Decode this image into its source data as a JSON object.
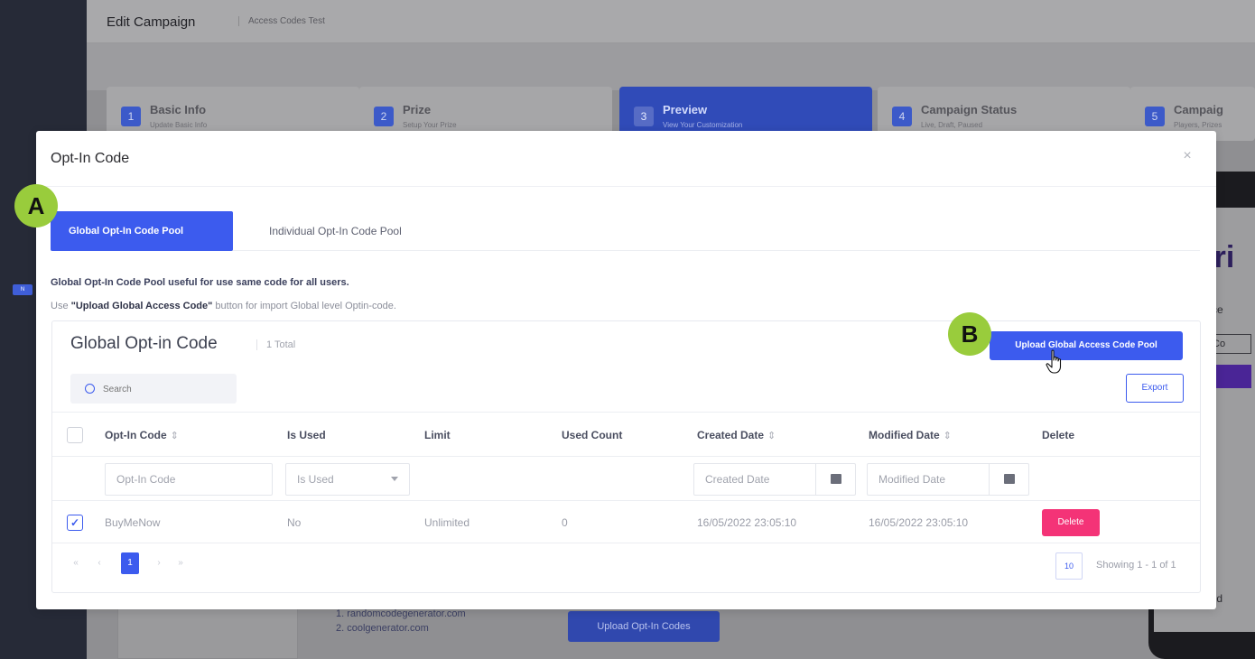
{
  "background": {
    "header_title": "Edit Campaign",
    "header_sub": "Access Codes Test",
    "steps": [
      {
        "num": "1",
        "title": "Basic Info",
        "sub": "Update Basic Info"
      },
      {
        "num": "2",
        "title": "Prize",
        "sub": "Setup Your Prize"
      },
      {
        "num": "3",
        "title": "Preview",
        "sub": "View Your Customization"
      },
      {
        "num": "4",
        "title": "Campaign Status",
        "sub": "Live, Draft, Paused"
      },
      {
        "num": "5",
        "title": "Campaig",
        "sub": "Players, Prizes"
      }
    ],
    "links": [
      "1. randomcodegenerator.com",
      "2. coolgenerator.com"
    ],
    "upload_optin_label": "Upload Opt-In Codes",
    "phone": {
      "pri": "Pri",
      "acce": "Acce",
      "ssco": "ss Co",
      "ered": "ered"
    },
    "rail_badge": "N"
  },
  "modal": {
    "title": "Opt-In Code",
    "close_glyph": "×",
    "tabs": [
      {
        "label": "Global Opt-In Code Pool",
        "active": true
      },
      {
        "label": "Individual Opt-In Code Pool",
        "active": false
      }
    ],
    "info_line1": "Global Opt-In Code Pool useful for use same code for all users.",
    "info_line2_pre": "Use ",
    "info_line2_bold": "\"Upload Global Access Code\"",
    "info_line2_post": " button for import Global level Optin-code.",
    "card": {
      "title": "Global Opt-in Code",
      "total": "1 Total",
      "upload_button": "Upload Global Access Code Pool",
      "search_placeholder": "Search",
      "export_button": "Export",
      "columns": {
        "code": "Opt-In Code",
        "used": "Is Used",
        "limit": "Limit",
        "used_count": "Used Count",
        "created": "Created Date",
        "modified": "Modified Date",
        "delete": "Delete"
      },
      "sort_glyph": "⇕",
      "filters": {
        "code": "Opt-In Code",
        "used": "Is Used",
        "created": "Created Date",
        "modified": "Modified Date"
      },
      "rows": [
        {
          "checked": true,
          "code": "BuyMeNow",
          "used": "No",
          "limit": "Unlimited",
          "used_count": "0",
          "created": "16/05/2022 23:05:10",
          "modified": "16/05/2022 23:05:10",
          "delete_label": "Delete"
        }
      ],
      "pagination": {
        "first": "«",
        "prev": "‹",
        "current": "1",
        "next": "›",
        "last": "»",
        "page_size": "10",
        "showing": "Showing 1 - 1 of 1"
      }
    }
  },
  "markers": {
    "a": "A",
    "b": "B"
  },
  "colors": {
    "primary": "#3c5bee",
    "danger": "#f43377",
    "marker": "#99cc3c"
  }
}
